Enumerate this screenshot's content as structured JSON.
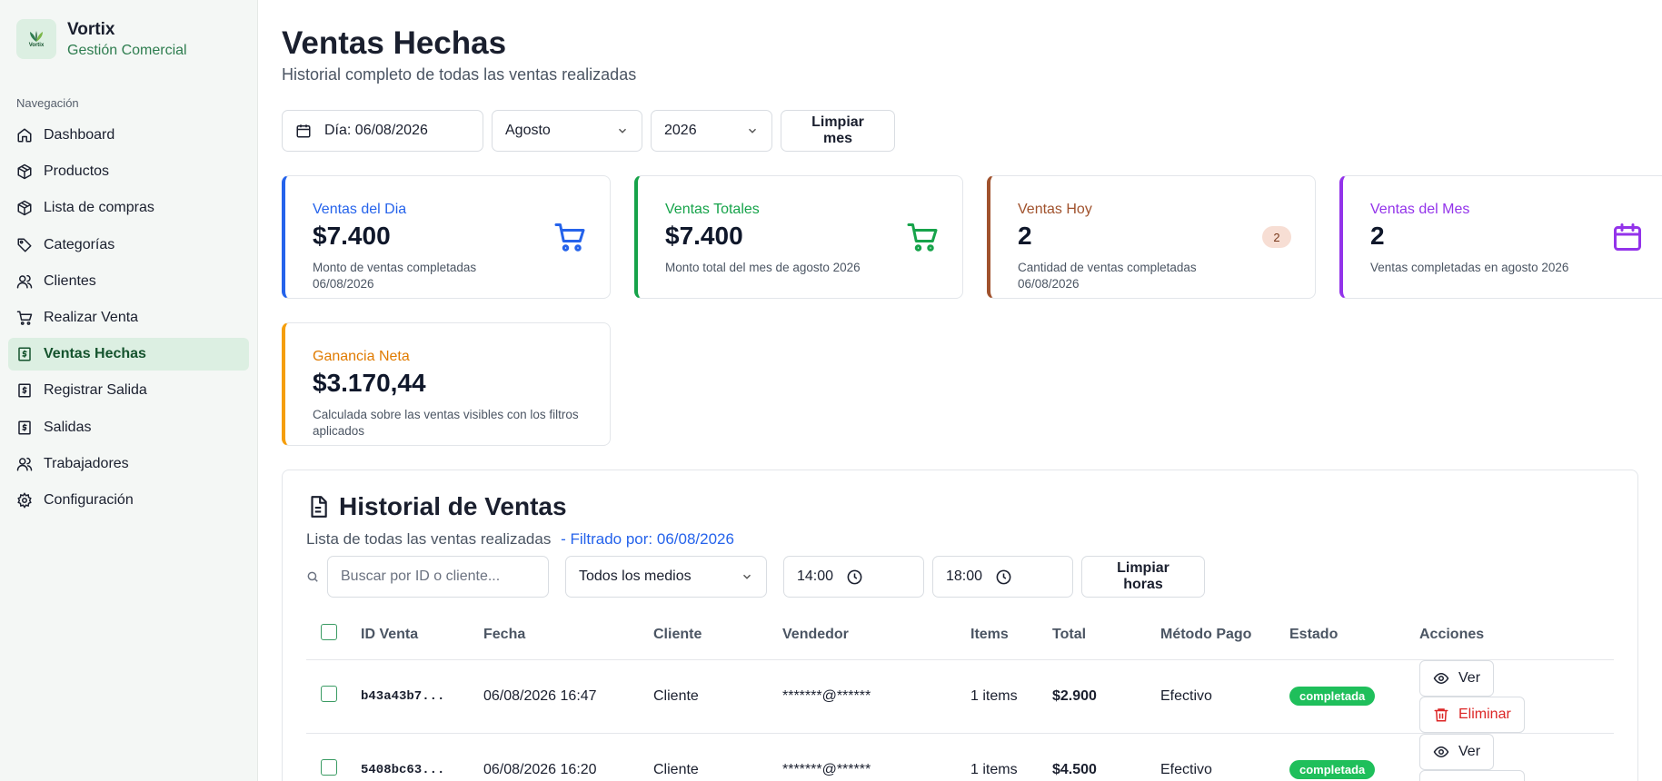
{
  "brand": {
    "name": "Vortix",
    "subtitle": "Gestión Comercial",
    "logo_text": "Vortix"
  },
  "sidebar": {
    "header": "Navegación",
    "items": [
      {
        "label": "Dashboard",
        "icon": "home-icon"
      },
      {
        "label": "Productos",
        "icon": "package-icon"
      },
      {
        "label": "Lista de compras",
        "icon": "package-icon"
      },
      {
        "label": "Categorías",
        "icon": "tag-icon"
      },
      {
        "label": "Clientes",
        "icon": "users-icon"
      },
      {
        "label": "Realizar Venta",
        "icon": "cart-icon"
      },
      {
        "label": "Ventas Hechas",
        "icon": "receipt-icon",
        "active": true
      },
      {
        "label": "Registrar Salida",
        "icon": "receipt-icon"
      },
      {
        "label": "Salidas",
        "icon": "receipt-icon"
      },
      {
        "label": "Trabajadores",
        "icon": "users-icon"
      },
      {
        "label": "Configuración",
        "icon": "gear-icon"
      }
    ]
  },
  "page": {
    "title": "Ventas Hechas",
    "subtitle": "Historial completo de todas las ventas realizadas"
  },
  "filters": {
    "day": "Día: 06/08/2026",
    "month": "Agosto",
    "year": "2026",
    "clear_month": "Limpiar mes"
  },
  "cards": [
    {
      "title": "Ventas del Dia",
      "value": "$7.400",
      "desc": "Monto de ventas completadas 06/08/2026",
      "color": "#2563eb",
      "icon": "cart-icon"
    },
    {
      "title": "Ventas Totales",
      "value": "$7.400",
      "desc": "Monto total del mes de agosto 2026",
      "color": "#16a34a",
      "icon": "cart-icon"
    },
    {
      "title": "Ventas Hoy",
      "value": "2",
      "desc": "Cantidad de ventas completadas 06/08/2026",
      "color": "#a0522d",
      "badge": "2"
    },
    {
      "title": "Ventas del Mes",
      "value": "2",
      "desc": "Ventas completadas en agosto 2026",
      "color": "#9333ea",
      "icon": "calendar-icon"
    },
    {
      "title": "Ganancia Neta",
      "value": "$3.170,44",
      "desc": "Calculada sobre las ventas visibles con los filtros aplicados",
      "color": "#f59e0b"
    }
  ],
  "history": {
    "title": "Historial de Ventas",
    "subtitle": "Lista de todas las ventas realizadas",
    "filter_note": "- Filtrado por: 06/08/2026",
    "search_placeholder": "Buscar por ID o cliente...",
    "payment_select": "Todos los medios",
    "time_from": "14:00",
    "time_to": "18:00",
    "clear_hours": "Limpiar horas",
    "columns": [
      "ID Venta",
      "Fecha",
      "Cliente",
      "Vendedor",
      "Items",
      "Total",
      "Método Pago",
      "Estado",
      "Acciones"
    ],
    "view_label": "Ver",
    "delete_label": "Eliminar",
    "rows": [
      {
        "id": "b43a43b7...",
        "date": "06/08/2026 16:47",
        "client": "Cliente",
        "seller": "*******@******",
        "items": "1 items",
        "total": "$2.900",
        "method": "Efectivo",
        "status": "completada"
      },
      {
        "id": "5408bc63...",
        "date": "06/08/2026 16:20",
        "client": "Cliente",
        "seller": "*******@******",
        "items": "1 items",
        "total": "$4.500",
        "method": "Efectivo",
        "status": "completada"
      }
    ]
  },
  "colors": {
    "accent": "#2e7d4f",
    "active_bg": "#dcefe2",
    "status_green": "#1fbf5b",
    "danger": "#dc2626"
  }
}
